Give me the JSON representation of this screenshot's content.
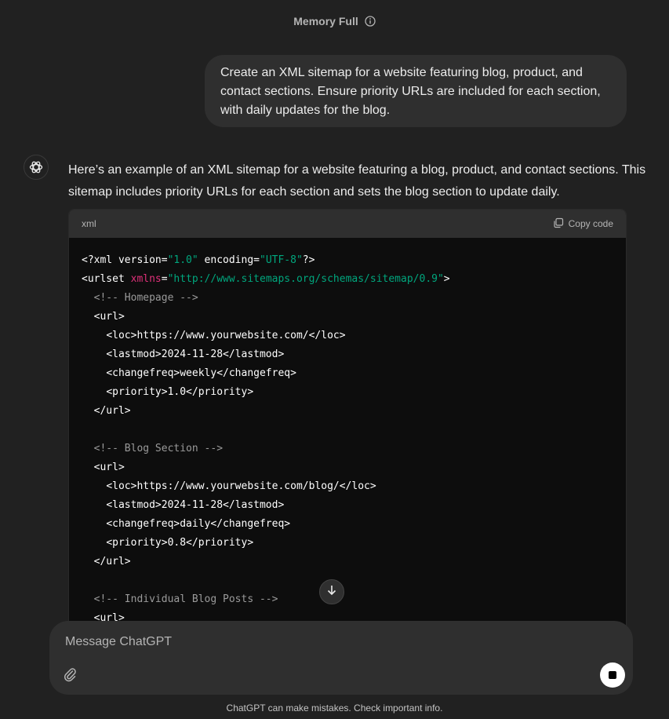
{
  "header": {
    "title": "Memory Full",
    "info_icon": "info-circle-icon"
  },
  "user_message": {
    "text": "Create an XML sitemap for a website featuring blog, product, and contact sections. Ensure priority URLs are included for each section, with daily updates for the blog."
  },
  "assistant": {
    "avatar_icon": "openai-logo-icon",
    "text": "Here’s an example of an XML sitemap for a website featuring a blog, product, and contact sections. This sitemap includes priority URLs for each section and sets the blog section to update daily."
  },
  "code_block": {
    "language": "xml",
    "copy_label": "Copy code",
    "copy_icon": "copy-icon",
    "lines": [
      {
        "indent": "",
        "parts": [
          {
            "t": "<?xml version=",
            "c": "tag"
          },
          {
            "t": "\"1.0\"",
            "c": "string"
          },
          {
            "t": " encoding=",
            "c": "tag"
          },
          {
            "t": "\"UTF-8\"",
            "c": "string"
          },
          {
            "t": "?>",
            "c": "tag"
          }
        ]
      },
      {
        "indent": "",
        "parts": [
          {
            "t": "<urlset ",
            "c": "tag"
          },
          {
            "t": "xmlns",
            "c": "attr"
          },
          {
            "t": "=",
            "c": "tag"
          },
          {
            "t": "\"http://www.sitemaps.org/schemas/sitemap/0.9\"",
            "c": "string"
          },
          {
            "t": ">",
            "c": "tag"
          }
        ]
      },
      {
        "indent": "  ",
        "parts": [
          {
            "t": "<!-- Homepage -->",
            "c": "comment"
          }
        ]
      },
      {
        "indent": "  ",
        "parts": [
          {
            "t": "<url>",
            "c": "tag"
          }
        ]
      },
      {
        "indent": "    ",
        "parts": [
          {
            "t": "<loc>https://www.yourwebsite.com/</loc>",
            "c": "tag"
          }
        ]
      },
      {
        "indent": "    ",
        "parts": [
          {
            "t": "<lastmod>2024-11-28</lastmod>",
            "c": "tag"
          }
        ]
      },
      {
        "indent": "    ",
        "parts": [
          {
            "t": "<changefreq>weekly</changefreq>",
            "c": "tag"
          }
        ]
      },
      {
        "indent": "    ",
        "parts": [
          {
            "t": "<priority>1.0</priority>",
            "c": "tag"
          }
        ]
      },
      {
        "indent": "  ",
        "parts": [
          {
            "t": "</url>",
            "c": "tag"
          }
        ]
      },
      {
        "indent": "",
        "parts": []
      },
      {
        "indent": "  ",
        "parts": [
          {
            "t": "<!-- Blog Section -->",
            "c": "comment"
          }
        ]
      },
      {
        "indent": "  ",
        "parts": [
          {
            "t": "<url>",
            "c": "tag"
          }
        ]
      },
      {
        "indent": "    ",
        "parts": [
          {
            "t": "<loc>https://www.yourwebsite.com/blog/</loc>",
            "c": "tag"
          }
        ]
      },
      {
        "indent": "    ",
        "parts": [
          {
            "t": "<lastmod>2024-11-28</lastmod>",
            "c": "tag"
          }
        ]
      },
      {
        "indent": "    ",
        "parts": [
          {
            "t": "<changefreq>daily</changefreq>",
            "c": "tag"
          }
        ]
      },
      {
        "indent": "    ",
        "parts": [
          {
            "t": "<priority>0.8</priority>",
            "c": "tag"
          }
        ]
      },
      {
        "indent": "  ",
        "parts": [
          {
            "t": "</url>",
            "c": "tag"
          }
        ]
      },
      {
        "indent": "",
        "parts": []
      },
      {
        "indent": "  ",
        "parts": [
          {
            "t": "<!-- Individual Blog Posts -->",
            "c": "comment"
          }
        ]
      },
      {
        "indent": "  ",
        "parts": [
          {
            "t": "<url>",
            "c": "tag"
          }
        ]
      }
    ]
  },
  "scroll_button": {
    "icon": "arrow-down-icon"
  },
  "composer": {
    "placeholder": "Message ChatGPT",
    "attach_icon": "paperclip-icon",
    "stop_icon": "stop-icon"
  },
  "footer": {
    "text": "ChatGPT can make mistakes. Check important info."
  },
  "colors": {
    "background": "#212121",
    "bubble": "#2f2f2f",
    "code_bg": "#0d0d0d",
    "string": "#00a67d",
    "attr": "#df3079",
    "comment": "#9a9a9a"
  }
}
